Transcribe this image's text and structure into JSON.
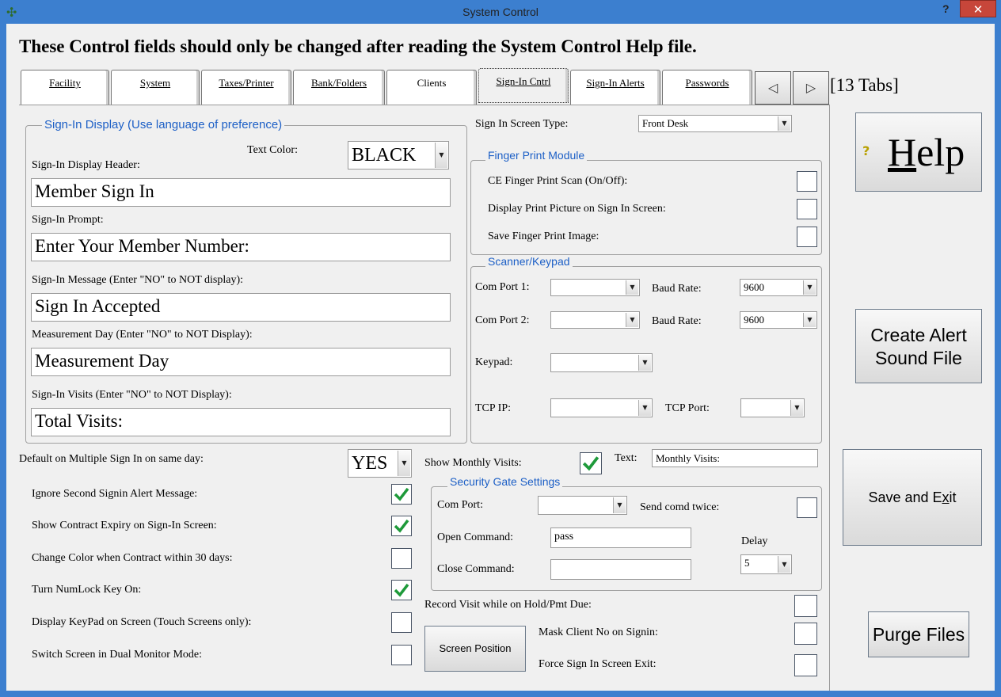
{
  "window": {
    "title": "System Control",
    "help_glyph": "?",
    "close_glyph": "✕"
  },
  "warning": "These Control fields should only be changed after reading the System Control Help file.",
  "tabs": [
    {
      "label": "Facility"
    },
    {
      "label": "System"
    },
    {
      "label": "Taxes/Printer"
    },
    {
      "label": "Bank/Folders"
    },
    {
      "label": "Clients"
    },
    {
      "label": "Sign-In Cntrl"
    },
    {
      "label": "Sign-In Alerts"
    },
    {
      "label": "Passwords"
    }
  ],
  "tabs_count": "[13 Tabs]",
  "display_group": {
    "legend": "Sign-In Display (Use language of preference)",
    "text_color_label": "Text Color:",
    "text_color_value": "BLACK",
    "header_label": "Sign-In Display Header:",
    "header_value": "Member Sign In",
    "prompt_label": "Sign-In Prompt:",
    "prompt_value": "Enter Your Member Number:",
    "message_label": "Sign-In Message (Enter \"NO\" to NOT display):",
    "message_value": "Sign In Accepted",
    "measurement_label": "Measurement Day (Enter \"NO\" to NOT Display):",
    "measurement_value": "Measurement Day",
    "visits_label": "Sign-In Visits (Enter \"NO\" to NOT Display):",
    "visits_value": "Total Visits:"
  },
  "sign_in_screen_type": {
    "label": "Sign In Screen Type:",
    "value": "Front Desk"
  },
  "finger_print": {
    "legend": "Finger Print Module",
    "ce_scan": "CE Finger Print Scan (On/Off):",
    "display_picture": "Display Print Picture on Sign In Screen:",
    "save_image": "Save Finger Print Image:"
  },
  "scanner": {
    "legend": "Scanner/Keypad",
    "com1_label": "Com Port 1:",
    "com1_value": "",
    "com2_label": "Com Port 2:",
    "com2_value": "",
    "baud_label": "Baud Rate:",
    "baud1_value": "9600",
    "baud2_value": "9600",
    "keypad_label": "Keypad:",
    "keypad_value": "",
    "tcp_ip_label": "TCP IP:",
    "tcp_ip_value": "",
    "tcp_port_label": "TCP Port:",
    "tcp_port_value": ""
  },
  "multiple_sign_in": {
    "label": "Default on Multiple Sign In on same day:",
    "value": "YES"
  },
  "options": [
    {
      "label": "Ignore Second Signin Alert Message:",
      "checked": true
    },
    {
      "label": "Show Contract Expiry on Sign-In Screen:",
      "checked": true
    },
    {
      "label": "Change Color when Contract within 30 days:",
      "checked": false
    },
    {
      "label": "Turn NumLock Key On:",
      "checked": true
    },
    {
      "label": "Display KeyPad on Screen (Touch Screens only):",
      "checked": false
    },
    {
      "label": "Switch Screen in Dual Monitor Mode:",
      "checked": false
    }
  ],
  "monthly_visits": {
    "label": "Show Monthly Visits:",
    "checked": true,
    "text_label": "Text:",
    "text_value": "Monthly Visits:"
  },
  "security_gate": {
    "legend": "Security Gate Settings",
    "com_port_label": "Com Port:",
    "com_port_value": "",
    "send_twice_label": "Send comd twice:",
    "open_label": "Open Command:",
    "open_value": "pass",
    "close_label": "Close Command:",
    "close_value": "",
    "delay_label": "Delay",
    "delay_value": "5"
  },
  "record_visit": {
    "label": "Record Visit while on Hold/Pmt Due:"
  },
  "mask_client": {
    "label": "Mask Client No on Signin:"
  },
  "force_exit": {
    "label": "Force Sign In Screen Exit:"
  },
  "screen_position_button": "Screen Position",
  "side_buttons": {
    "help_glyph": "?",
    "help": "Help",
    "create_alert_line1": "Create Alert",
    "create_alert_line2": "Sound File",
    "save_exit": "Save and Exit",
    "purge": "Purge Files"
  },
  "colors": {
    "titlebar": "#3c7fcf",
    "legend": "#1c5fc6",
    "check": "#1e9a3a",
    "close": "#c7463a"
  }
}
